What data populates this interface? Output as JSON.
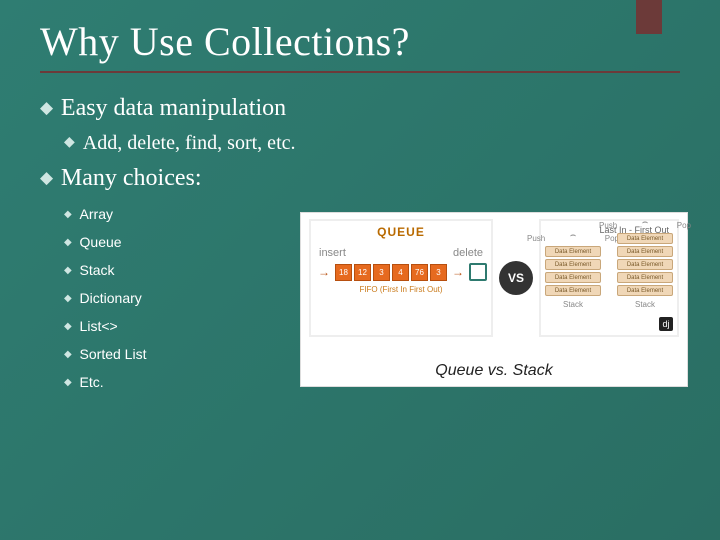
{
  "title": "Why Use Collections?",
  "bullets": {
    "p1": {
      "text": "Easy data manipulation",
      "sub": {
        "s1": "Add, delete, find, sort, etc."
      }
    },
    "p2": {
      "text": "Many choices:",
      "sub": {
        "c1": "Array",
        "c2": "Queue",
        "c3": "Stack",
        "c4": "Dictionary",
        "c5": "List<>",
        "c6": "Sorted List",
        "c7": "Etc."
      }
    }
  },
  "figure": {
    "queue_title": "QUEUE",
    "insert_label": "insert",
    "delete_label": "delete",
    "fifo": "FIFO (First In First Out)",
    "cells": [
      "18",
      "12",
      "3",
      "4",
      "76",
      "3"
    ],
    "vs": "VS",
    "lifo": "Last In - First Out",
    "push": "Push",
    "pop": "Pop",
    "stack_label": "Stack",
    "slot": "Data Element",
    "badge": "dj",
    "caption": "Queue vs. Stack"
  }
}
